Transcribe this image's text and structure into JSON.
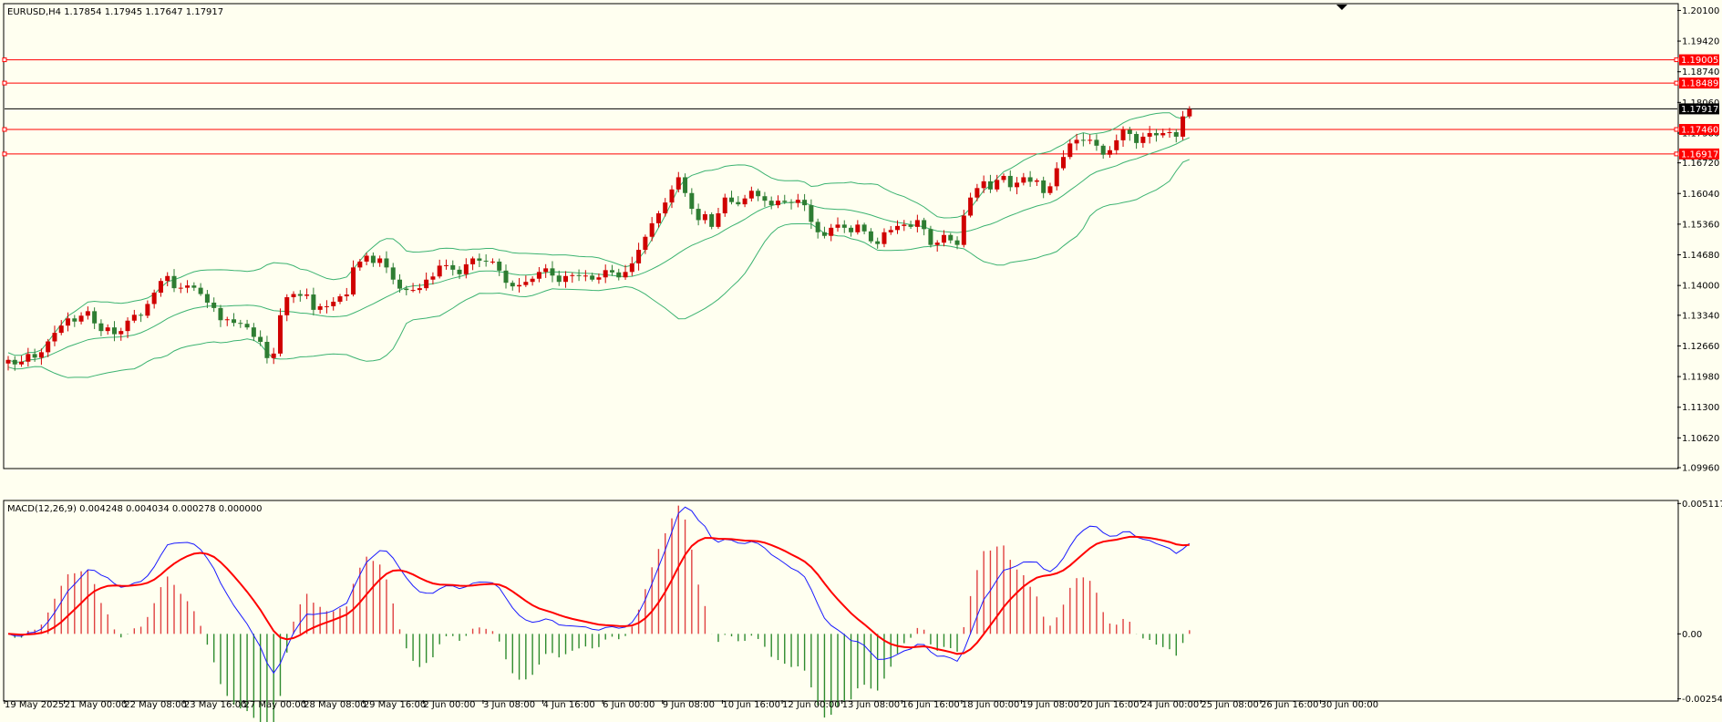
{
  "symbol_info": "EURUSD,H4  1.17854 1.17945 1.17647 1.17917",
  "macd_info": "MACD(12,26,9) 0.004248 0.004034 0.000278 0.000000",
  "colors": {
    "background": "#fffff0",
    "bull": "#d00000",
    "bear": "#2e7d32",
    "band": "#3cb371",
    "macd_line": "#1a1aff",
    "signal_line": "#ff0000",
    "hist_pos": "#e04040",
    "hist_neg": "#2e8b2e",
    "level_line": "#ff0000",
    "current_price": "#000000"
  },
  "price_axis": {
    "min": 1.0996,
    "max": 1.2023,
    "ticks": [
      "1.20100",
      "1.19420",
      "1.18740",
      "1.18060",
      "1.17380",
      "1.16720",
      "1.16040",
      "1.15360",
      "1.14680",
      "1.14000",
      "1.13340",
      "1.12660",
      "1.11980",
      "1.11300",
      "1.10620",
      "1.09960"
    ]
  },
  "macd_axis": {
    "min": -0.0026,
    "max": 0.0052,
    "ticks": [
      "0.005117",
      "0.00",
      "-0.002548"
    ]
  },
  "horizontal_levels": [
    {
      "price": 1.19005,
      "label": "1.19005"
    },
    {
      "price": 1.18489,
      "label": "1.18489"
    },
    {
      "price": 1.1746,
      "label": "1.17460"
    },
    {
      "price": 1.16917,
      "label": "1.16917"
    }
  ],
  "current_price": {
    "price": 1.17917,
    "label": "1.17917"
  },
  "time_axis": [
    "19 May 2025",
    "21 May 00:00",
    "22 May 08:00",
    "23 May 16:00",
    "27 May 00:00",
    "28 May 08:00",
    "29 May 16:00",
    "2 Jun 00:00",
    "3 Jun 08:00",
    "4 Jun 16:00",
    "6 Jun 00:00",
    "9 Jun 08:00",
    "10 Jun 16:00",
    "12 Jun 00:00",
    "13 Jun 08:00",
    "16 Jun 16:00",
    "18 Jun 00:00",
    "19 Jun 08:00",
    "20 Jun 16:00",
    "24 Jun 00:00",
    "25 Jun 08:00",
    "26 Jun 16:00",
    "30 Jun 00:00"
  ],
  "chart_data": {
    "type": "candlestick",
    "symbol": "EURUSD",
    "timeframe": "H4",
    "series_close": [
      1.1235,
      1.1225,
      1.1231,
      1.1248,
      1.124,
      1.1252,
      1.1276,
      1.1295,
      1.1311,
      1.1327,
      1.132,
      1.1333,
      1.1343,
      1.1316,
      1.1299,
      1.1307,
      1.1292,
      1.1299,
      1.1322,
      1.1335,
      1.1333,
      1.1359,
      1.1384,
      1.141,
      1.1421,
      1.1394,
      1.1395,
      1.14,
      1.1395,
      1.1381,
      1.1362,
      1.135,
      1.1323,
      1.1325,
      1.1317,
      1.1315,
      1.1307,
      1.1286,
      1.1275,
      1.1239,
      1.1249,
      1.1334,
      1.1374,
      1.1381,
      1.1377,
      1.138,
      1.1346,
      1.1354,
      1.1354,
      1.1364,
      1.1376,
      1.138,
      1.144,
      1.1453,
      1.1466,
      1.145,
      1.146,
      1.144,
      1.1413,
      1.1393,
      1.139,
      1.139,
      1.1394,
      1.1413,
      1.142,
      1.1444,
      1.1445,
      1.1435,
      1.1425,
      1.1447,
      1.146,
      1.1455,
      1.1453,
      1.1453,
      1.1433,
      1.1406,
      1.1398,
      1.1401,
      1.1408,
      1.1415,
      1.143,
      1.1438,
      1.1422,
      1.1408,
      1.1421,
      1.1423,
      1.1422,
      1.1422,
      1.1413,
      1.1418,
      1.1434,
      1.1429,
      1.1418,
      1.143,
      1.1449,
      1.1479,
      1.1508,
      1.1538,
      1.156,
      1.1584,
      1.1613,
      1.164,
      1.1605,
      1.157,
      1.1545,
      1.1558,
      1.153,
      1.156,
      1.1595,
      1.1585,
      1.158,
      1.1593,
      1.161,
      1.1598,
      1.1588,
      1.1578,
      1.1588,
      1.1585,
      1.1583,
      1.159,
      1.1578,
      1.1541,
      1.1518,
      1.151,
      1.1528,
      1.1535,
      1.1528,
      1.1518,
      1.1535,
      1.152,
      1.1498,
      1.1492,
      1.1518,
      1.1523,
      1.1532,
      1.1535,
      1.153,
      1.1545,
      1.1525,
      1.149,
      1.1495,
      1.1512,
      1.15,
      1.149,
      1.1555,
      1.1595,
      1.1616,
      1.1631,
      1.1613,
      1.1634,
      1.1643,
      1.1618,
      1.1628,
      1.164,
      1.163,
      1.1633,
      1.1605,
      1.162,
      1.166,
      1.1685,
      1.1715,
      1.1723,
      1.1721,
      1.1723,
      1.171,
      1.169,
      1.17,
      1.1722,
      1.1745,
      1.1736,
      1.1716,
      1.173,
      1.1738,
      1.1733,
      1.1738,
      1.174,
      1.173,
      1.1775,
      1.1791
    ]
  }
}
